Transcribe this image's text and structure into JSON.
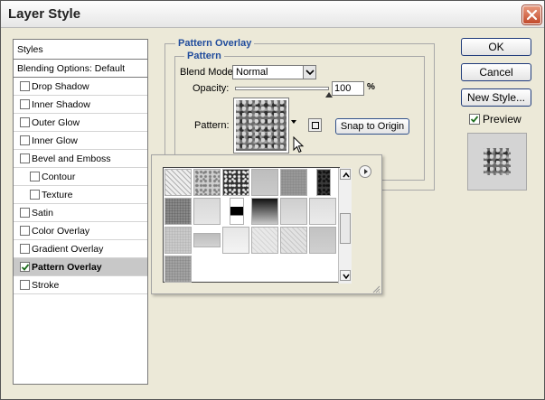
{
  "window": {
    "title": "Layer Style"
  },
  "styles_panel": {
    "header": "Styles",
    "blending_options": "Blending Options: Default",
    "items": [
      {
        "label": "Drop Shadow",
        "checked": false,
        "indent": false
      },
      {
        "label": "Inner Shadow",
        "checked": false,
        "indent": false
      },
      {
        "label": "Outer Glow",
        "checked": false,
        "indent": false
      },
      {
        "label": "Inner Glow",
        "checked": false,
        "indent": false
      },
      {
        "label": "Bevel and Emboss",
        "checked": false,
        "indent": false
      },
      {
        "label": "Contour",
        "checked": false,
        "indent": true
      },
      {
        "label": "Texture",
        "checked": false,
        "indent": true
      },
      {
        "label": "Satin",
        "checked": false,
        "indent": false
      },
      {
        "label": "Color Overlay",
        "checked": false,
        "indent": false
      },
      {
        "label": "Gradient Overlay",
        "checked": false,
        "indent": false
      },
      {
        "label": "Pattern Overlay",
        "checked": true,
        "indent": false,
        "selected": true
      },
      {
        "label": "Stroke",
        "checked": false,
        "indent": false
      }
    ]
  },
  "pattern_overlay": {
    "group_title": "Pattern Overlay",
    "sub_title": "Pattern",
    "blend_mode_label": "Blend Mode:",
    "blend_mode_value": "Normal",
    "opacity_label": "Opacity:",
    "opacity_value": "100",
    "opacity_unit": "%",
    "opacity_level": 1.0,
    "pattern_label": "Pattern:",
    "snap_button": "Snap to Origin"
  },
  "buttons": {
    "ok": "OK",
    "cancel": "Cancel",
    "new_style": "New Style..."
  },
  "preview": {
    "label": "Preview",
    "checked": true
  },
  "pattern_picker": {
    "scroll_position": 0.55,
    "patterns": [
      {
        "icon": "diagonal-lines-pattern-icon",
        "base": "#eeeeee",
        "ink": "#b0b0b0",
        "kind": "diag"
      },
      {
        "icon": "clouds-pattern-icon",
        "base": "#cfcfcf",
        "ink": "#7d7d7d",
        "kind": "noise"
      },
      {
        "icon": "dark-splatter-pattern-icon",
        "base": "#303030",
        "ink": "#f2f2f2",
        "kind": "noise"
      },
      {
        "icon": "gray-canvas-pattern-icon",
        "base": "#cacaca",
        "ink": "#bdbdbd",
        "kind": "flat"
      },
      {
        "icon": "fine-gray-pattern-icon",
        "base": "#9a9a9a",
        "ink": "#8a8a8a",
        "kind": "dots"
      },
      {
        "icon": "dark-rock-pattern-icon",
        "base": "#3a3a3a",
        "ink": "#0e0e0e",
        "kind": "noise",
        "narrow": true
      },
      {
        "icon": "gray-weave-pattern-icon",
        "base": "#8e8e8e",
        "ink": "#6a6a6a",
        "kind": "dots"
      },
      {
        "icon": "light-paper-pattern-icon",
        "base": "#e6e6e6",
        "ink": "#d8d8d8",
        "kind": "flat"
      },
      {
        "icon": "black-white-gradient-pattern-icon",
        "base": "#ffffff",
        "ink": "#000000",
        "kind": "vgrad",
        "narrow": true
      },
      {
        "icon": "dark-gradient-pattern-icon",
        "base": "#c8c8c8",
        "ink": "#111111",
        "kind": "grad"
      },
      {
        "icon": "light-marble-pattern-icon",
        "base": "#e0e0e0",
        "ink": "#cecece",
        "kind": "flat"
      },
      {
        "icon": "pale-linen-pattern-icon",
        "base": "#ebebeb",
        "ink": "#dddddd",
        "kind": "flat"
      },
      {
        "icon": "gray-burlap-pattern-icon",
        "base": "#cdcdcd",
        "ink": "#b6b6b6",
        "kind": "dots"
      },
      {
        "icon": "gray-stripe-pattern-icon",
        "base": "#d2d2d2",
        "ink": "#bcbcbc",
        "kind": "flat",
        "short": true
      },
      {
        "icon": "white-paper-pattern-icon",
        "base": "#f4f4f4",
        "ink": "#e6e6e6",
        "kind": "flat"
      },
      {
        "icon": "light-wrinkle-pattern-icon",
        "base": "#e8e8e8",
        "ink": "#d6d6d6",
        "kind": "diag"
      },
      {
        "icon": "light-diagonal-pattern-icon",
        "base": "#e2e2e2",
        "ink": "#c8c8c8",
        "kind": "diag"
      },
      {
        "icon": "gray-felt-pattern-icon",
        "base": "#d0d0d0",
        "ink": "#c2c2c2",
        "kind": "flat"
      },
      {
        "icon": "gray-dots-pattern-icon",
        "base": "#a6a6a6",
        "ink": "#8a8a8a",
        "kind": "dots"
      }
    ]
  }
}
